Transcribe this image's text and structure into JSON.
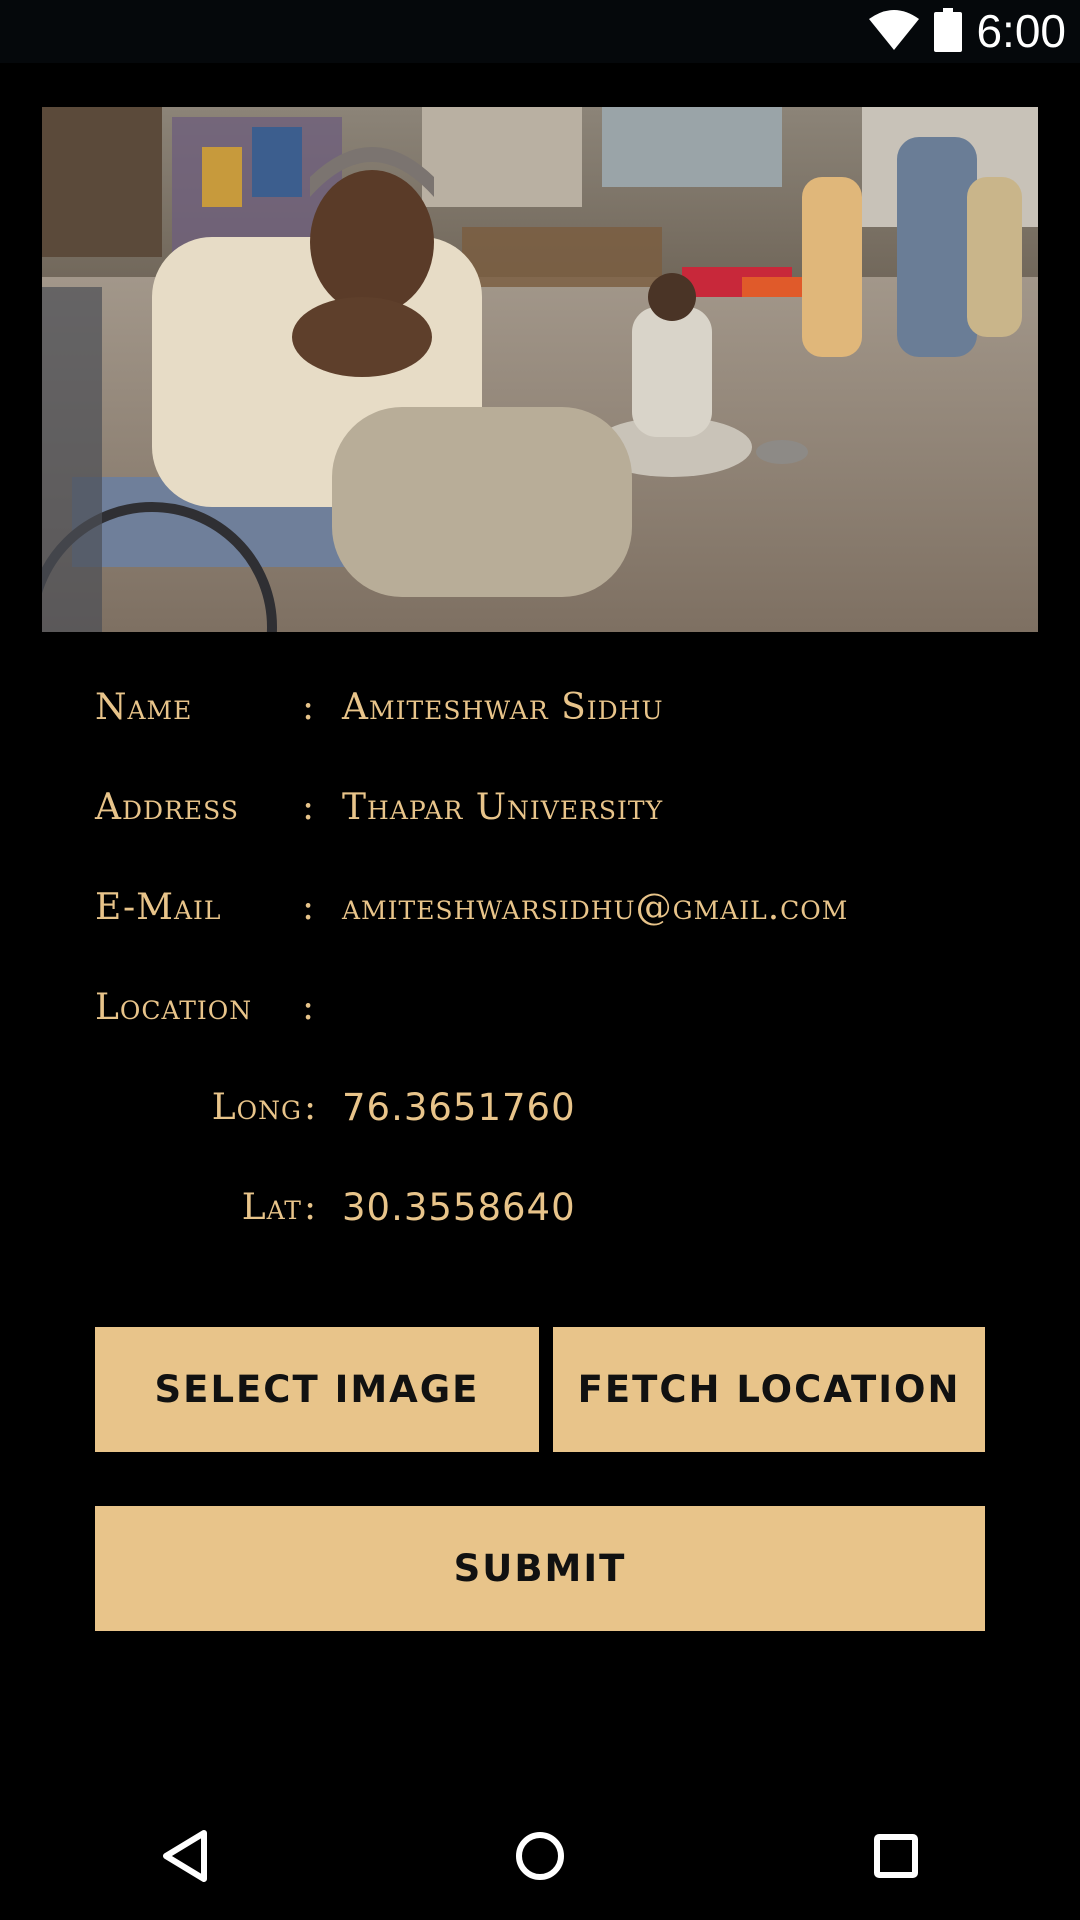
{
  "status_bar": {
    "time": "6:00"
  },
  "photo": {
    "description_icon": "street-photo"
  },
  "profile": {
    "name_label": "Name",
    "name_value": "Amiteshwar Sidhu",
    "address_label": "Address",
    "address_value": "Thapar University",
    "email_label": "E-Mail",
    "email_value": "amiteshwarsidhu@gmail.com",
    "location_label": "Location",
    "long_label": "Long",
    "long_value": "76.3651760",
    "lat_label": "Lat",
    "lat_value": "30.3558640",
    "colon": ":"
  },
  "actions": {
    "select_image_label": "SELECT IMAGE",
    "fetch_location_label": "FETCH LOCATION",
    "submit_label": "SUBMIT"
  },
  "nav_bar": {
    "back_icon": "back-triangle-icon",
    "home_icon": "home-circle-icon",
    "recents_icon": "recents-square-icon"
  },
  "colors": {
    "accent": "#e8c48a",
    "background": "#000000",
    "status_bar": "#05080b"
  }
}
